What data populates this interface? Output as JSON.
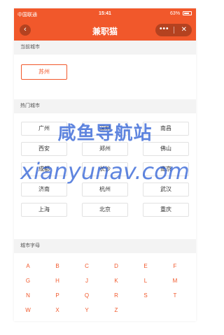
{
  "status_bar": {
    "carrier": "中国联通",
    "time": "15:41",
    "battery": "63%"
  },
  "nav": {
    "title": "兼职猫",
    "back_icon": "‹",
    "more_icon": "•••",
    "close_icon": "✕"
  },
  "current": {
    "heading": "当前城市",
    "city": "苏州"
  },
  "hot": {
    "heading": "热门城市",
    "cities": [
      "广州",
      "深圳",
      "南昌",
      "西安",
      "郑州",
      "佛山",
      "成都",
      "长沙",
      "南京",
      "济南",
      "杭州",
      "武汉",
      "上海",
      "北京",
      "重庆"
    ]
  },
  "letters": {
    "heading": "城市字母",
    "items": [
      "A",
      "B",
      "C",
      "D",
      "E",
      "F",
      "G",
      "H",
      "J",
      "K",
      "L",
      "M",
      "N",
      "P",
      "Q",
      "R",
      "S",
      "T",
      "W",
      "X",
      "Y",
      "Z"
    ]
  },
  "watermark": {
    "line1": "咸鱼导航站",
    "line2": "xianyunav.com"
  },
  "colors": {
    "accent": "#f1582b",
    "section_bg": "#f3f3f3",
    "watermark": "#2156d2"
  }
}
